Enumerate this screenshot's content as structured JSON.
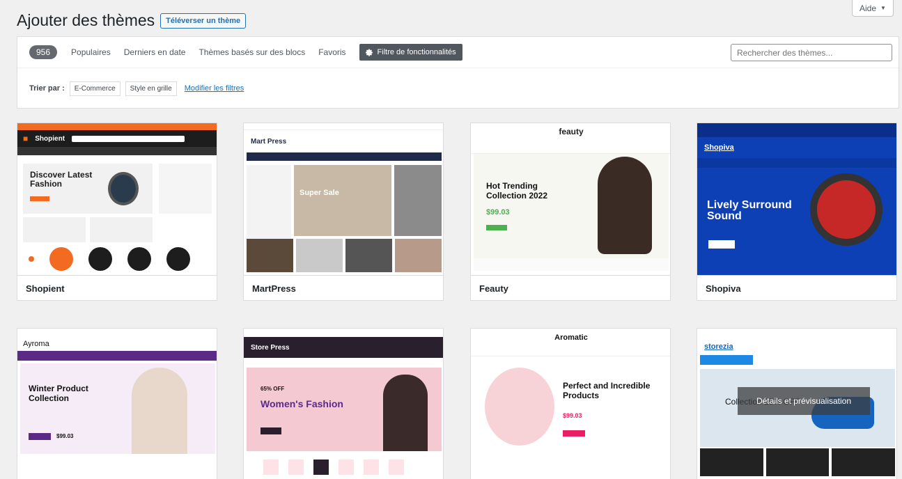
{
  "help": {
    "label": "Aide"
  },
  "header": {
    "title": "Ajouter des thèmes",
    "upload_label": "Téléverser un thème"
  },
  "filters": {
    "count": "956",
    "tabs": [
      "Populaires",
      "Derniers en date",
      "Thèmes basés sur des blocs",
      "Favoris"
    ],
    "feature_filter_label": "Filtre de fonctionnalités",
    "search_placeholder": "Rechercher des thèmes...",
    "sort_label": "Trier par :",
    "tags": [
      "E-Commerce",
      "Style en grille"
    ],
    "modify_label": "Modifier les filtres"
  },
  "themes": [
    {
      "name": "Shopient",
      "logo": "Shopient",
      "headline": "Discover Latest Fashion",
      "accent": "#f26b21"
    },
    {
      "name": "MartPress",
      "logo": "Mart Press",
      "headline": "Super Sale",
      "accent": "#1f2a4a"
    },
    {
      "name": "Feauty",
      "logo": "feauty",
      "headline": "Hot Trending Collection 2022",
      "price": "$99.03",
      "accent": "#4caf50"
    },
    {
      "name": "Shopiva",
      "logo": "Shopiva",
      "headline": "Lively Surround Sound",
      "accent": "#0d3fb5"
    },
    {
      "name": "Ayroma",
      "logo": "Ayroma",
      "headline": "Winter Product Collection",
      "price": "$99.03",
      "accent": "#5b2a86"
    },
    {
      "name": "StorePress",
      "logo": "Store Press",
      "headline": "Women's Fashion",
      "sub": "65% OFF",
      "accent": "#2a1f2d"
    },
    {
      "name": "Aromatic",
      "logo": "Aromatic",
      "headline": "Perfect and Incredible Products",
      "price": "$99.03",
      "accent": "#e91e63"
    },
    {
      "name": "Storezia",
      "logo": "storezia",
      "headline": "Collection 25% OFF",
      "accent": "#1565c0"
    }
  ],
  "preview_overlay": "Détails et prévisualisation",
  "icons": {
    "feature": "gear-icon",
    "help_caret": "caret-down-icon"
  }
}
